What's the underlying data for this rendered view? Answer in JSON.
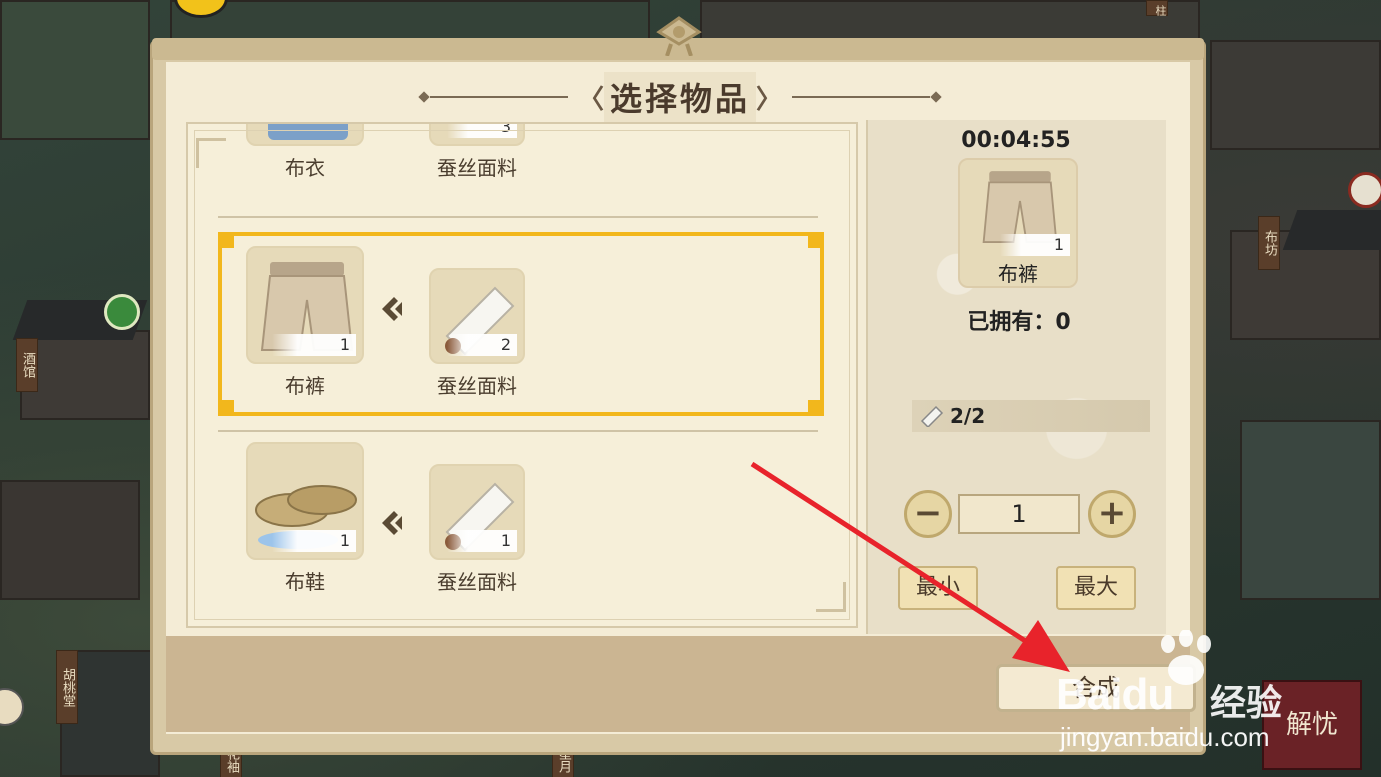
{
  "modal": {
    "title": "选择物品"
  },
  "recipes": [
    {
      "product_name": "布衣",
      "material_name": "蚕丝面料",
      "material_count": "3"
    },
    {
      "product_name": "布裤",
      "product_count": "1",
      "material_name": "蚕丝面料",
      "material_count": "2",
      "selected": true
    },
    {
      "product_name": "布鞋",
      "product_count": "1",
      "material_name": "蚕丝面料",
      "material_count": "1"
    }
  ],
  "detail": {
    "timer": "00:04:55",
    "item_name": "布裤",
    "item_count": "1",
    "owned_label": "已拥有：",
    "owned_value": "0",
    "material_qty": "2/2",
    "quantity": "1",
    "min_label": "最小",
    "max_label": "最大",
    "craft_label": "合成"
  },
  "world_signs": [
    "酒馆",
    "布坊",
    "胡桃堂",
    "花袖",
    "星月",
    "柱"
  ],
  "corner_button": "解忧",
  "watermark": {
    "brand": "Baidu",
    "suffix": "经验",
    "url": "jingyan.baidu.com"
  },
  "colors": {
    "selection": "#f2b71c",
    "annotation_arrow": "#e8232b",
    "panel": "#f4ecd6"
  }
}
